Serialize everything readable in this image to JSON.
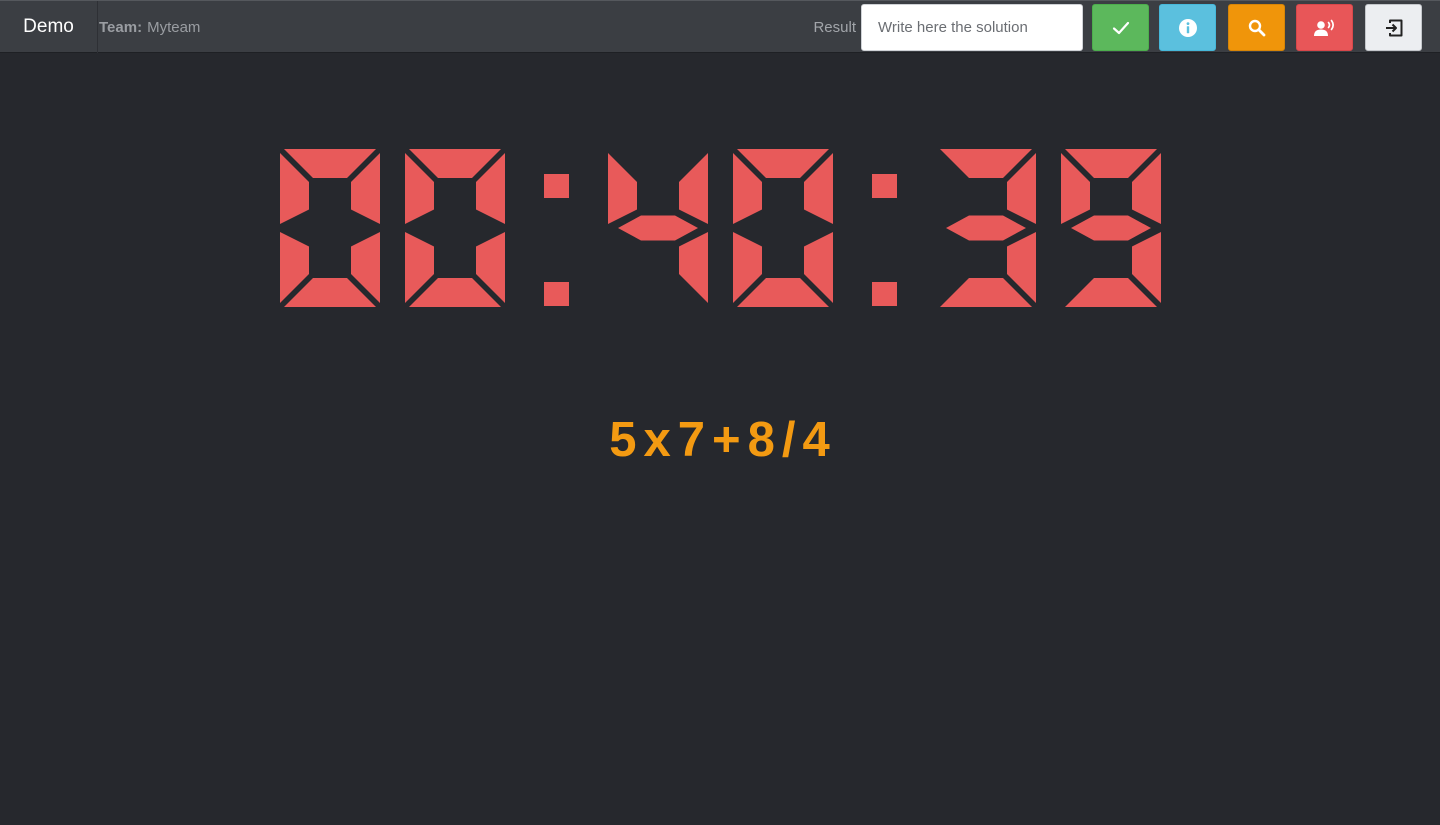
{
  "app": {
    "brand": "Demo"
  },
  "team": {
    "label": "Team:",
    "name": "Myteam"
  },
  "result": {
    "label": "Result",
    "placeholder": "Write here the solution",
    "value": ""
  },
  "buttons": {
    "submit_icon": "check-icon",
    "info_icon": "info-icon",
    "search_icon": "search-icon",
    "voice_icon": "voice-icon",
    "exit_icon": "exit-icon"
  },
  "timer": {
    "display": "00:40:39",
    "color": "#e85a5a"
  },
  "problem": {
    "tokens": [
      "5",
      "x",
      "7",
      "+",
      "8",
      "/",
      "4"
    ],
    "color": "#f39a12"
  },
  "colors": {
    "background": "#26282d",
    "navbar": "#3b3e43",
    "success": "#5cb85c",
    "info": "#5bc0de",
    "warning": "#f0950a",
    "danger": "#e85658",
    "light": "#eceef1"
  }
}
